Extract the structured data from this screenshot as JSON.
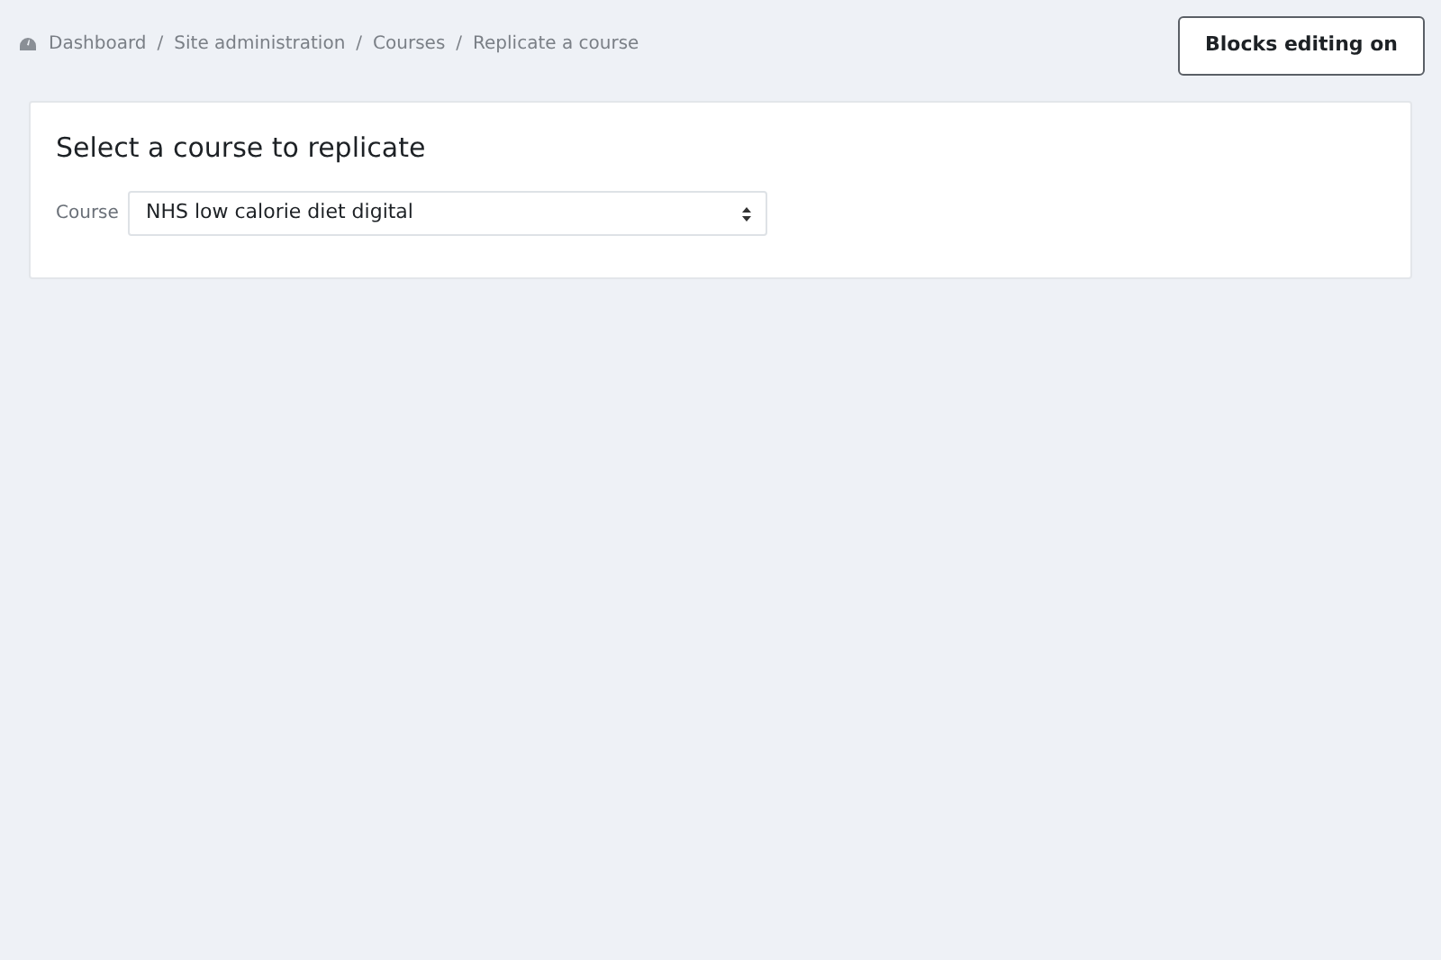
{
  "breadcrumb": [
    "Dashboard",
    "Site administration",
    "Courses",
    "Replicate a course"
  ],
  "breadcrumb_separator": "/",
  "edit_button": "Blocks editing on",
  "card": {
    "title": "Select a course to replicate",
    "field_label": "Course",
    "select_value": "NHS low calorie diet digital"
  }
}
